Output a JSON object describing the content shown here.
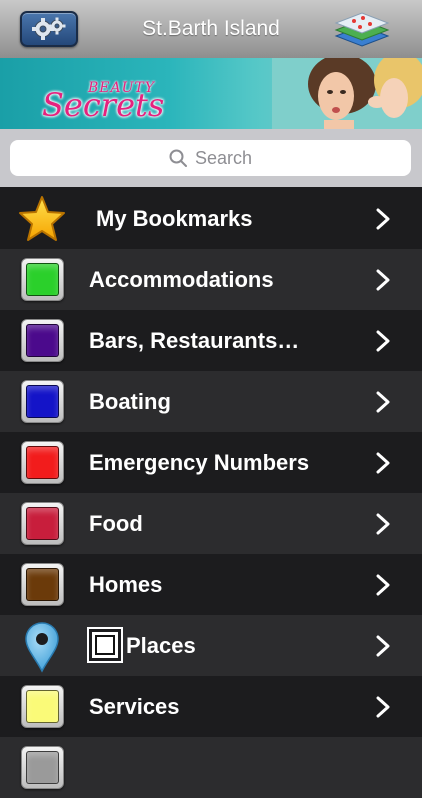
{
  "header": {
    "title": "St.Barth Island",
    "left_icon": "settings-gears-icon",
    "right_icon": "map-layers-icon"
  },
  "banner": {
    "small_text": "BEAUTY",
    "big_text": "Secrets"
  },
  "search": {
    "placeholder": "Search",
    "icon": "search-icon"
  },
  "list": {
    "items": [
      {
        "label": "My Bookmarks",
        "icon": "star-icon"
      },
      {
        "label": "Accommodations",
        "icon": "swatch-icon",
        "color": "#2bd02b"
      },
      {
        "label": "Bars, Restaurants…",
        "icon": "swatch-icon",
        "color": "#4b0a8c"
      },
      {
        "label": "Boating",
        "icon": "swatch-icon",
        "color": "#1414c8"
      },
      {
        "label": "Emergency Numbers",
        "icon": "swatch-icon",
        "color": "#f21c1c"
      },
      {
        "label": "Food",
        "icon": "swatch-icon",
        "color": "#c81e3c"
      },
      {
        "label": "Homes",
        "icon": "swatch-icon",
        "color": "#6b3a0a"
      },
      {
        "label": "Places",
        "icon": "map-pin-icon",
        "color": "#5ab4e6"
      },
      {
        "label": "Services",
        "icon": "swatch-icon",
        "color": "#fafa78"
      }
    ]
  }
}
